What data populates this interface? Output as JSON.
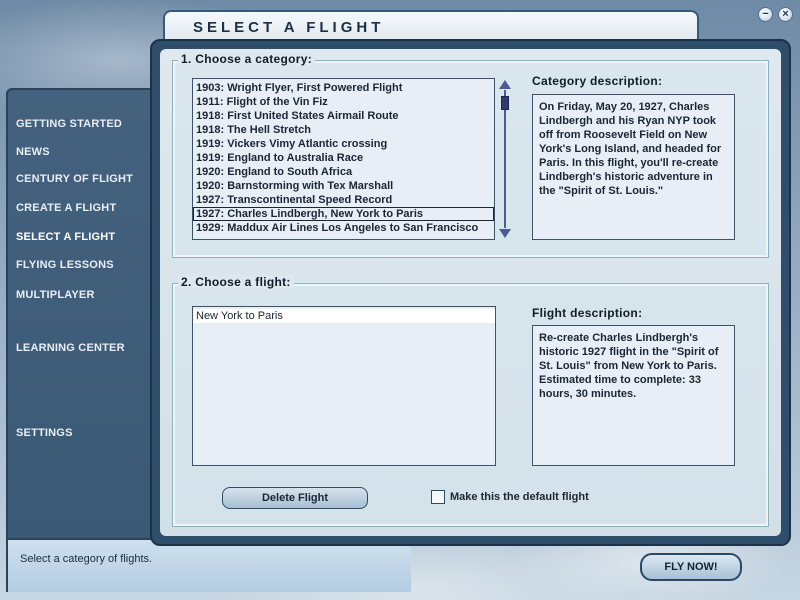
{
  "window": {
    "title": "SELECT A FLIGHT",
    "minimize_symbol": "−",
    "close_symbol": "×"
  },
  "nav": {
    "items": [
      {
        "label": "GETTING STARTED",
        "active": false
      },
      {
        "label": "NEWS",
        "active": false
      },
      {
        "label": "CENTURY OF FLIGHT",
        "active": false
      },
      {
        "label": "CREATE A FLIGHT",
        "active": false
      },
      {
        "label": "SELECT A FLIGHT",
        "active": true
      },
      {
        "label": "FLYING LESSONS",
        "active": false
      },
      {
        "label": "MULTIPLAYER",
        "active": false
      },
      {
        "label": "LEARNING CENTER",
        "active": false
      },
      {
        "label": "SETTINGS",
        "active": false
      }
    ]
  },
  "category_section": {
    "label": "1. Choose a category:",
    "items": [
      "1903: Wright Flyer, First Powered Flight",
      "1911: Flight of the Vin Fiz",
      "1918: First United States Airmail Route",
      "1918: The Hell Stretch",
      "1919: Vickers Vimy Atlantic crossing",
      "1919: England to Australia Race",
      "1920: England to South Africa",
      "1920: Barnstorming with Tex Marshall",
      "1927: Transcontinental Speed Record",
      "1927: Charles Lindbergh, New York to Paris",
      "1929: Maddux Air Lines Los Angeles to San Francisco"
    ],
    "selected_index": 9,
    "description_label": "Category description:",
    "description": "On Friday, May 20, 1927, Charles Lindbergh and his Ryan NYP took off from Roosevelt Field on New York's Long Island, and headed for Paris. In this flight, you'll re-create Lindbergh's historic adventure in the \"Spirit of St. Louis.\""
  },
  "flight_section": {
    "label": "2. Choose a flight:",
    "items": [
      "New York to Paris"
    ],
    "selected_index": 0,
    "description_label": "Flight description:",
    "description": "Re-create Charles Lindbergh's historic 1927 flight in the \"Spirit of St. Louis\" from New York to Paris. Estimated time to complete: 33 hours, 30 minutes."
  },
  "actions": {
    "delete_label": "Delete Flight",
    "default_checkbox_label": "Make this the default flight",
    "default_checked": false,
    "fly_now_label": "FLY NOW!"
  },
  "status": {
    "text": "Select a category of flights."
  }
}
